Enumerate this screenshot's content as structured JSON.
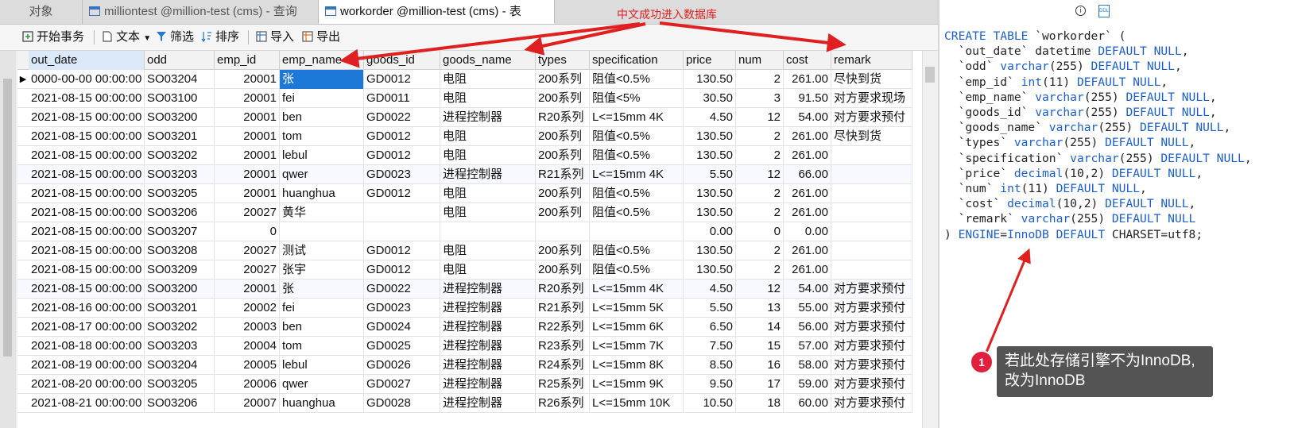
{
  "tabs": [
    {
      "label": "对象"
    },
    {
      "label": "milliontest @million-test (cms) - 查询"
    },
    {
      "label": "workorder @million-test (cms) - 表"
    }
  ],
  "toolbar": {
    "begin_tx": "开始事务",
    "text": "文本",
    "filter": "筛选",
    "sort": "排序",
    "import": "导入",
    "export": "导出"
  },
  "table": {
    "columns": [
      "out_date",
      "odd",
      "emp_id",
      "emp_name",
      "goods_id",
      "goods_name",
      "types",
      "specification",
      "price",
      "num",
      "cost",
      "remark"
    ],
    "rows": [
      [
        "0000-00-00 00:00:00",
        "SO03204",
        "20001",
        "张",
        "GD0012",
        "电阻",
        "200系列",
        "阻值<0.5%",
        "130.50",
        "2",
        "261.00",
        "尽快到货"
      ],
      [
        "2021-08-15 00:00:00",
        "SO03100",
        "20001",
        "fei",
        "GD0011",
        "电阻",
        "200系列",
        "阻值<5%",
        "30.50",
        "3",
        "91.50",
        "对方要求现场"
      ],
      [
        "2021-08-15 00:00:00",
        "SO03200",
        "20001",
        "ben",
        "GD0022",
        "进程控制器",
        "R20系列",
        "L<=15mm 4K",
        "4.50",
        "12",
        "54.00",
        "对方要求预付"
      ],
      [
        "2021-08-15 00:00:00",
        "SO03201",
        "20001",
        "tom",
        "GD0012",
        "电阻",
        "200系列",
        "阻值<0.5%",
        "130.50",
        "2",
        "261.00",
        "尽快到货"
      ],
      [
        "2021-08-15 00:00:00",
        "SO03202",
        "20001",
        "lebul",
        "GD0012",
        "电阻",
        "200系列",
        "阻值<0.5%",
        "130.50",
        "2",
        "261.00",
        ""
      ],
      [
        "2021-08-15 00:00:00",
        "SO03203",
        "20001",
        "qwer",
        "GD0023",
        "进程控制器",
        "R21系列",
        "L<=15mm 4K",
        "5.50",
        "12",
        "66.00",
        ""
      ],
      [
        "2021-08-15 00:00:00",
        "SO03205",
        "20001",
        "huanghua",
        "GD0012",
        "电阻",
        "200系列",
        "阻值<0.5%",
        "130.50",
        "2",
        "261.00",
        ""
      ],
      [
        "2021-08-15 00:00:00",
        "SO03206",
        "20027",
        "黄华",
        "",
        "电阻",
        "200系列",
        "阻值<0.5%",
        "130.50",
        "2",
        "261.00",
        ""
      ],
      [
        "2021-08-15 00:00:00",
        "SO03207",
        "0",
        "",
        "",
        "",
        "",
        "",
        "0.00",
        "0",
        "0.00",
        ""
      ],
      [
        "2021-08-15 00:00:00",
        "SO03208",
        "20027",
        "测试",
        "GD0012",
        "电阻",
        "200系列",
        "阻值<0.5%",
        "130.50",
        "2",
        "261.00",
        ""
      ],
      [
        "2021-08-15 00:00:00",
        "SO03209",
        "20027",
        "张宇",
        "GD0012",
        "电阻",
        "200系列",
        "阻值<0.5%",
        "130.50",
        "2",
        "261.00",
        ""
      ],
      [
        "2021-08-15 00:00:00",
        "SO03200",
        "20001",
        "张",
        "GD0022",
        "进程控制器",
        "R20系列",
        "L<=15mm 4K",
        "4.50",
        "12",
        "54.00",
        "对方要求预付"
      ],
      [
        "2021-08-16 00:00:00",
        "SO03201",
        "20002",
        "fei",
        "GD0023",
        "进程控制器",
        "R21系列",
        "L<=15mm 5K",
        "5.50",
        "13",
        "55.00",
        "对方要求预付"
      ],
      [
        "2021-08-17 00:00:00",
        "SO03202",
        "20003",
        "ben",
        "GD0024",
        "进程控制器",
        "R22系列",
        "L<=15mm 6K",
        "6.50",
        "14",
        "56.00",
        "对方要求预付"
      ],
      [
        "2021-08-18 00:00:00",
        "SO03203",
        "20004",
        "tom",
        "GD0025",
        "进程控制器",
        "R23系列",
        "L<=15mm 7K",
        "7.50",
        "15",
        "57.00",
        "对方要求预付"
      ],
      [
        "2021-08-19 00:00:00",
        "SO03204",
        "20005",
        "lebul",
        "GD0026",
        "进程控制器",
        "R24系列",
        "L<=15mm 8K",
        "8.50",
        "16",
        "58.00",
        "对方要求预付"
      ],
      [
        "2021-08-20 00:00:00",
        "SO03205",
        "20006",
        "qwer",
        "GD0027",
        "进程控制器",
        "R25系列",
        "L<=15mm 9K",
        "9.50",
        "17",
        "59.00",
        "对方要求预付"
      ],
      [
        "2021-08-21 00:00:00",
        "SO03206",
        "20007",
        "huanghua",
        "GD0028",
        "进程控制器",
        "R26系列",
        "L<=15mm 10K",
        "10.50",
        "18",
        "60.00",
        "对方要求预付"
      ]
    ]
  },
  "ddl": {
    "lines": [
      [
        [
          "kw",
          "CREATE TABLE"
        ],
        [
          "t",
          " `workorder` ("
        ]
      ],
      [
        [
          "t",
          "  `out_date` "
        ],
        [
          "t",
          "datetime "
        ],
        [
          "kw",
          "DEFAULT NULL"
        ],
        [
          "t",
          ","
        ]
      ],
      [
        [
          "t",
          "  `odd` "
        ],
        [
          "kw",
          "varchar"
        ],
        [
          "t",
          "(255) "
        ],
        [
          "kw",
          "DEFAULT NULL"
        ],
        [
          "t",
          ","
        ]
      ],
      [
        [
          "t",
          "  `emp_id` "
        ],
        [
          "kw",
          "int"
        ],
        [
          "t",
          "(11) "
        ],
        [
          "kw",
          "DEFAULT NULL"
        ],
        [
          "t",
          ","
        ]
      ],
      [
        [
          "t",
          "  `emp_name` "
        ],
        [
          "kw",
          "varchar"
        ],
        [
          "t",
          "(255) "
        ],
        [
          "kw",
          "DEFAULT NULL"
        ],
        [
          "t",
          ","
        ]
      ],
      [
        [
          "t",
          "  `goods_id` "
        ],
        [
          "kw",
          "varchar"
        ],
        [
          "t",
          "(255) "
        ],
        [
          "kw",
          "DEFAULT NULL"
        ],
        [
          "t",
          ","
        ]
      ],
      [
        [
          "t",
          "  `goods_name` "
        ],
        [
          "kw",
          "varchar"
        ],
        [
          "t",
          "(255) "
        ],
        [
          "kw",
          "DEFAULT NULL"
        ],
        [
          "t",
          ","
        ]
      ],
      [
        [
          "t",
          "  `types` "
        ],
        [
          "kw",
          "varchar"
        ],
        [
          "t",
          "(255) "
        ],
        [
          "kw",
          "DEFAULT NULL"
        ],
        [
          "t",
          ","
        ]
      ],
      [
        [
          "t",
          "  `specification` "
        ],
        [
          "kw",
          "varchar"
        ],
        [
          "t",
          "(255) "
        ],
        [
          "kw",
          "DEFAULT NULL"
        ],
        [
          "t",
          ","
        ]
      ],
      [
        [
          "t",
          "  `price` "
        ],
        [
          "kw",
          "decimal"
        ],
        [
          "t",
          "(10,2) "
        ],
        [
          "kw",
          "DEFAULT NULL"
        ],
        [
          "t",
          ","
        ]
      ],
      [
        [
          "t",
          "  `num` "
        ],
        [
          "kw",
          "int"
        ],
        [
          "t",
          "(11) "
        ],
        [
          "kw",
          "DEFAULT NULL"
        ],
        [
          "t",
          ","
        ]
      ],
      [
        [
          "t",
          "  `cost` "
        ],
        [
          "kw",
          "decimal"
        ],
        [
          "t",
          "(10,2) "
        ],
        [
          "kw",
          "DEFAULT NULL"
        ],
        [
          "t",
          ","
        ]
      ],
      [
        [
          "t",
          "  `remark` "
        ],
        [
          "kw",
          "varchar"
        ],
        [
          "t",
          "(255) "
        ],
        [
          "kw",
          "DEFAULT NULL"
        ]
      ],
      [
        [
          "t",
          ") "
        ],
        [
          "kw",
          "ENGINE"
        ],
        [
          "t",
          "="
        ],
        [
          "kw",
          "InnoDB"
        ],
        [
          "t",
          " "
        ],
        [
          "kw",
          "DEFAULT"
        ],
        [
          "t",
          " CHARSET=utf8;"
        ]
      ]
    ]
  },
  "annotations": {
    "top_note": "中文成功进入数据库",
    "callout_number": "1",
    "callout_line1": "若此处存储引擎不为InnoDB,",
    "callout_line2": "改为InnoDB",
    "color": "#e02020"
  },
  "ddl_tools": {
    "info_icon": "info-icon",
    "ddl_icon": "ddl-icon"
  }
}
